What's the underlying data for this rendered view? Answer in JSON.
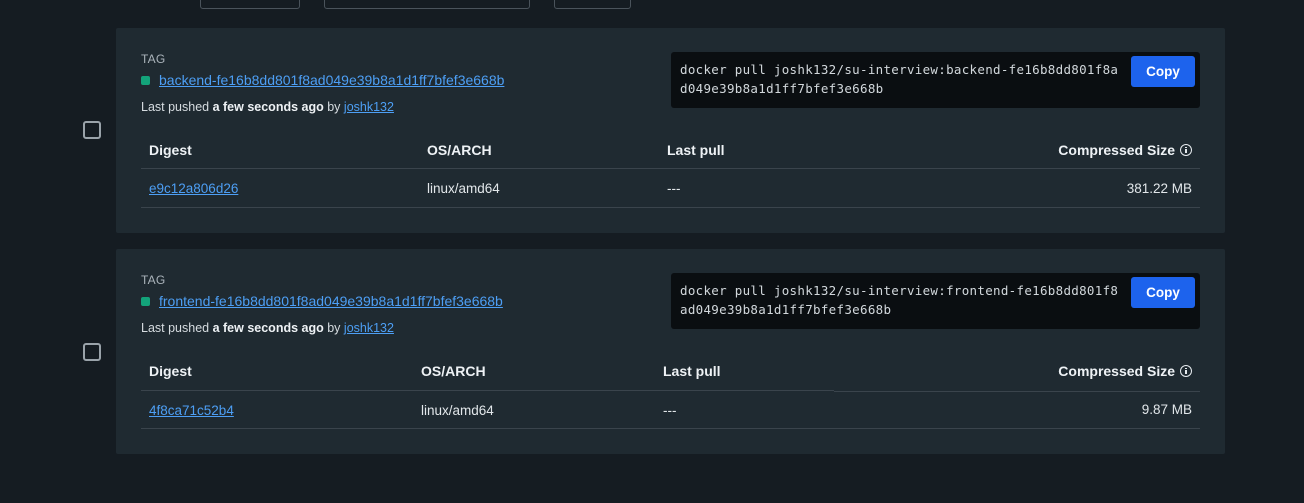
{
  "repository": "joshk132/su-interview",
  "tags": [
    {
      "section_label": "TAG",
      "name": "backend-fe16b8dd801f8ad049e39b8a1d1ff7bfef3e668b",
      "pushed_prefix": "Last pushed",
      "pushed_time": "a few seconds ago",
      "pushed_by_word": "by",
      "pushed_by": "joshk132",
      "pull_command": "docker pull joshk132/su-interview:backend-fe16b8dd801f8ad049e39b8a1d1ff7bfef3e668b",
      "copy_label": "Copy",
      "columns": [
        "Digest",
        "OS/ARCH",
        "Last pull",
        "Compressed Size"
      ],
      "rows": [
        {
          "digest": "e9c12a806d26",
          "os_arch": "linux/amd64",
          "last_pull": "---",
          "size": "381.22 MB"
        }
      ]
    },
    {
      "section_label": "TAG",
      "name": "frontend-fe16b8dd801f8ad049e39b8a1d1ff7bfef3e668b",
      "pushed_prefix": "Last pushed",
      "pushed_time": "a few seconds ago",
      "pushed_by_word": "by",
      "pushed_by": "joshk132",
      "pull_command": "docker pull joshk132/su-interview:frontend-fe16b8dd801f8ad049e39b8a1d1ff7bfef3e668b",
      "copy_label": "Copy",
      "columns": [
        "Digest",
        "OS/ARCH",
        "Last pull",
        "Compressed Size"
      ],
      "rows": [
        {
          "digest": "4f8ca71c52b4",
          "os_arch": "linux/amd64",
          "last_pull": "---",
          "size": "9.87 MB"
        }
      ]
    }
  ],
  "colors": {
    "background": "#151c22",
    "card": "#1f2a31",
    "accent": "#1d63ed",
    "link": "#4d9ff5",
    "status_active": "#13a37a"
  },
  "icons": [
    "info-icon",
    "checkbox-icon",
    "status-dot-icon"
  ]
}
